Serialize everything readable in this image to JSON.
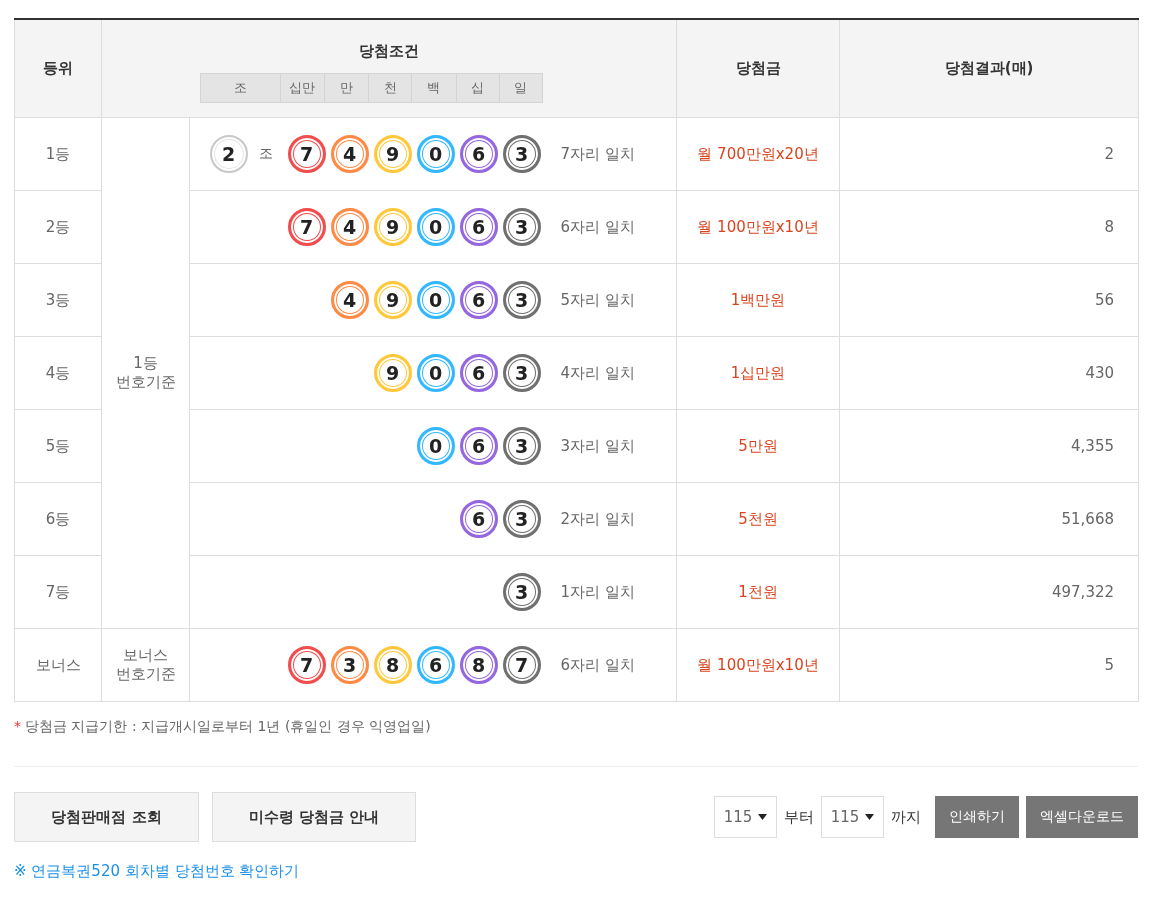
{
  "table": {
    "columns": [
      {
        "label": "등위"
      },
      {
        "label": "당첨조건"
      },
      {
        "label": "당첨금"
      },
      {
        "label": "당첨결과(매)"
      }
    ],
    "positions": [
      "조",
      "십만",
      "만",
      "천",
      "백",
      "십",
      "일"
    ],
    "groups": [
      {
        "basis_lines": [
          "1등",
          "번호기준"
        ],
        "rows": [
          {
            "rank": "1등",
            "balls": [
              {
                "digit": "2",
                "kind": "jo",
                "unit": "조",
                "color": "#c8c8c8"
              },
              {
                "digit": "7",
                "kind": "digit",
                "color": "#f24d4d"
              },
              {
                "digit": "4",
                "kind": "digit",
                "color": "#ff8a45"
              },
              {
                "digit": "9",
                "kind": "digit",
                "color": "#ffc83a"
              },
              {
                "digit": "0",
                "kind": "digit",
                "color": "#33b8ff"
              },
              {
                "digit": "6",
                "kind": "digit",
                "color": "#9467de"
              },
              {
                "digit": "3",
                "kind": "digit",
                "color": "#707070"
              }
            ],
            "match": "7자리 일치",
            "prize": "월 700만원x20년",
            "count": "2"
          },
          {
            "rank": "2등",
            "balls": [
              {
                "digit": "7",
                "kind": "digit",
                "color": "#f24d4d"
              },
              {
                "digit": "4",
                "kind": "digit",
                "color": "#ff8a45"
              },
              {
                "digit": "9",
                "kind": "digit",
                "color": "#ffc83a"
              },
              {
                "digit": "0",
                "kind": "digit",
                "color": "#33b8ff"
              },
              {
                "digit": "6",
                "kind": "digit",
                "color": "#9467de"
              },
              {
                "digit": "3",
                "kind": "digit",
                "color": "#707070"
              }
            ],
            "match": "6자리 일치",
            "prize": "월 100만원x10년",
            "count": "8"
          },
          {
            "rank": "3등",
            "balls": [
              {
                "digit": "4",
                "kind": "digit",
                "color": "#ff8a45"
              },
              {
                "digit": "9",
                "kind": "digit",
                "color": "#ffc83a"
              },
              {
                "digit": "0",
                "kind": "digit",
                "color": "#33b8ff"
              },
              {
                "digit": "6",
                "kind": "digit",
                "color": "#9467de"
              },
              {
                "digit": "3",
                "kind": "digit",
                "color": "#707070"
              }
            ],
            "match": "5자리 일치",
            "prize": "1백만원",
            "count": "56"
          },
          {
            "rank": "4등",
            "balls": [
              {
                "digit": "9",
                "kind": "digit",
                "color": "#ffc83a"
              },
              {
                "digit": "0",
                "kind": "digit",
                "color": "#33b8ff"
              },
              {
                "digit": "6",
                "kind": "digit",
                "color": "#9467de"
              },
              {
                "digit": "3",
                "kind": "digit",
                "color": "#707070"
              }
            ],
            "match": "4자리 일치",
            "prize": "1십만원",
            "count": "430"
          },
          {
            "rank": "5등",
            "balls": [
              {
                "digit": "0",
                "kind": "digit",
                "color": "#33b8ff"
              },
              {
                "digit": "6",
                "kind": "digit",
                "color": "#9467de"
              },
              {
                "digit": "3",
                "kind": "digit",
                "color": "#707070"
              }
            ],
            "match": "3자리 일치",
            "prize": "5만원",
            "count": "4,355"
          },
          {
            "rank": "6등",
            "balls": [
              {
                "digit": "6",
                "kind": "digit",
                "color": "#9467de"
              },
              {
                "digit": "3",
                "kind": "digit",
                "color": "#707070"
              }
            ],
            "match": "2자리 일치",
            "prize": "5천원",
            "count": "51,668"
          },
          {
            "rank": "7등",
            "balls": [
              {
                "digit": "3",
                "kind": "digit",
                "color": "#707070"
              }
            ],
            "match": "1자리 일치",
            "prize": "1천원",
            "count": "497,322"
          }
        ]
      },
      {
        "basis_lines": [
          "보너스",
          "번호기준"
        ],
        "rows": [
          {
            "rank": "보너스",
            "balls": [
              {
                "digit": "7",
                "kind": "digit",
                "color": "#f24d4d"
              },
              {
                "digit": "3",
                "kind": "digit",
                "color": "#ff8a45"
              },
              {
                "digit": "8",
                "kind": "digit",
                "color": "#ffc83a"
              },
              {
                "digit": "6",
                "kind": "digit",
                "color": "#33b8ff"
              },
              {
                "digit": "8",
                "kind": "digit",
                "color": "#9467de"
              },
              {
                "digit": "7",
                "kind": "digit",
                "color": "#707070"
              }
            ],
            "match": "6자리 일치",
            "prize": "월 100만원x10년",
            "count": "5"
          }
        ]
      }
    ]
  },
  "note": {
    "mark": "*",
    "text": "당첨금 지급기한 : 지급개시일로부터 1년 (휴일인 경우 익영업일)"
  },
  "buttons": [
    "당첨판매점 조회",
    "미수령 당첨금 안내"
  ],
  "range": {
    "from": "115",
    "from_label": "부터",
    "to": "115",
    "to_label": "까지"
  },
  "actions": [
    "인쇄하기",
    "엑셀다운로드"
  ],
  "link": "※ 연금복권520 회차별 당첨번호 확인하기"
}
